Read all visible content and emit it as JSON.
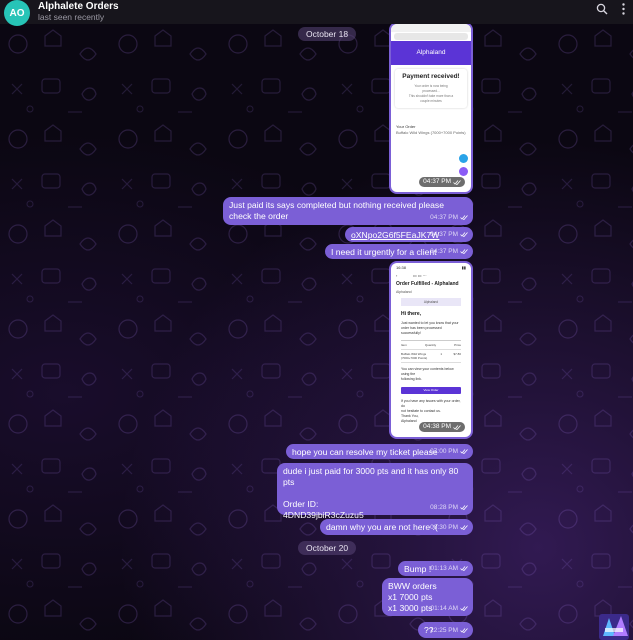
{
  "header": {
    "avatar_initials": "AO",
    "title": "Alphalete Orders",
    "status": "last seen recently",
    "icons": [
      "search-icon",
      "more-vert-icon"
    ]
  },
  "colors": {
    "bubble": "#7b5fd6",
    "avatar": "#27c4b7",
    "header_bg": "#17151c",
    "brand": "#5b34d6"
  },
  "dates": [
    "October 18",
    "October 20"
  ],
  "screenshot1": {
    "brand": "Alphaland",
    "heading": "Payment received!",
    "line1": "Your order is now being",
    "line2": "processed...",
    "line3": "This shouldn't take more than a",
    "line4": "couple minutes",
    "order_label": "Your Order",
    "item": "Buffalo Wild Wings (7000+7000 Points)",
    "time": "04:37 PM"
  },
  "screenshot2": {
    "clock": "16:38",
    "subject": "Order Fulfilled - Alphaland",
    "sender": "Alphaland",
    "banner": "Alphaland",
    "greeting": "Hi there,",
    "body1": "Just wanted to let you know that your",
    "body2": "order has been processed successfully!",
    "col1": "Item",
    "col2": "Quantity",
    "col3": "Price",
    "row_item": "Buffalo Wild Wings (7000+7000 Points)",
    "row_qty": "1",
    "row_price": "$7.80",
    "body3": "You can view your contents below using the",
    "body4": "following link.",
    "button": "View Order",
    "body5": "If you have any issues with your order, do",
    "body6": "not hesitate to contact us.",
    "sign1": "Thank You,",
    "sign2": "Alphaland",
    "time": "04:38 PM"
  },
  "messages": [
    {
      "text": "Just paid its says completed but nothing received please check the order",
      "time": "04:37 PM"
    },
    {
      "text": "oXNpo2G6f5FEaJK7W",
      "time": "04:37 PM"
    },
    {
      "text": "I need it urgently for a client",
      "time": "04:37 PM"
    },
    {
      "text": "hope you can resolve my ticket please",
      "time": "07:00 PM"
    },
    {
      "text": "dude i just paid for 3000 pts and it has only 80 pts\n\nOrder ID:\n4DND39jbiR3cZuzu5",
      "time": "08:28 PM"
    },
    {
      "text": "damn why you are not here :(",
      "time": "08:30 PM"
    },
    {
      "text": "Bump !",
      "time": "01:13 AM"
    },
    {
      "text": "BWW orders\nx1 7000 pts\nx1 3000 pts",
      "time": "01:14 AM"
    },
    {
      "text": "??",
      "time": "12:25 PM"
    }
  ]
}
